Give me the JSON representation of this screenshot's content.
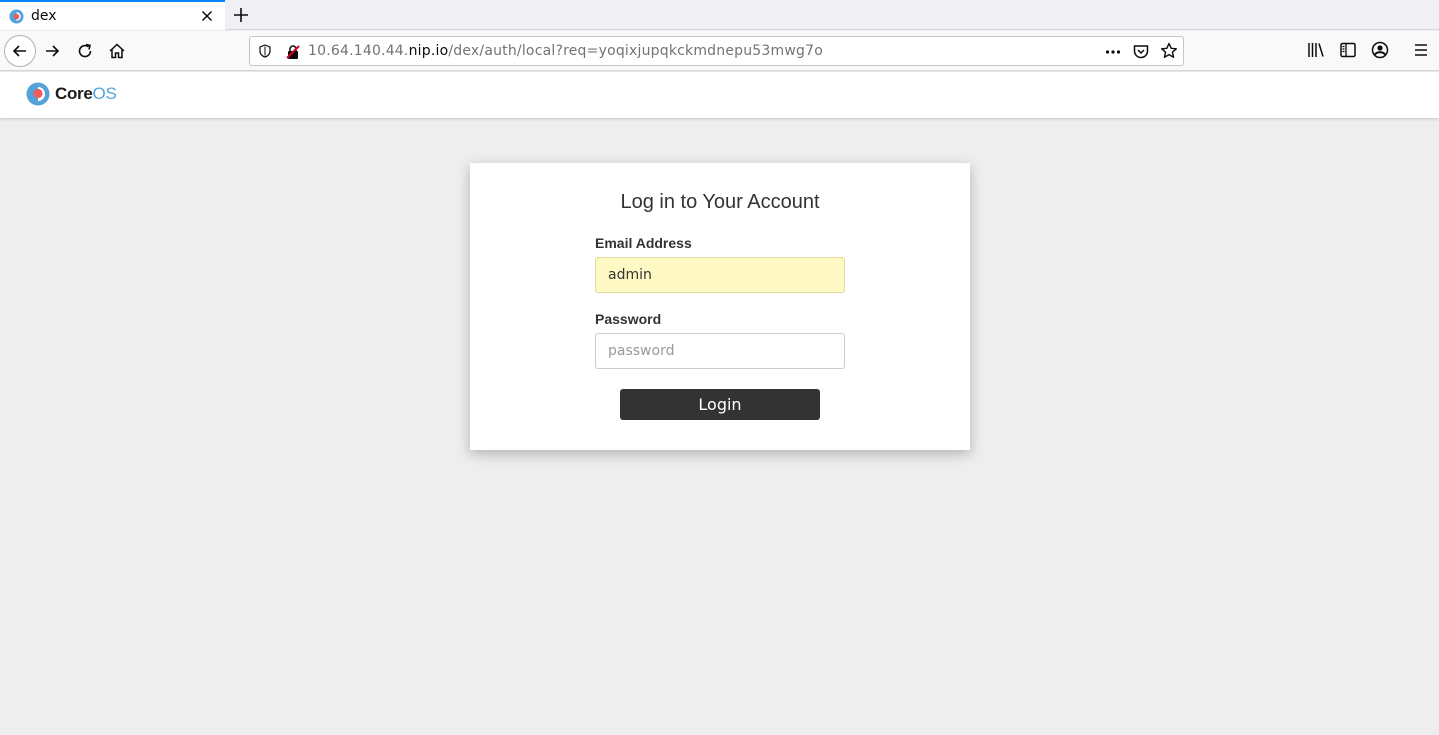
{
  "browser": {
    "tab_title": "dex",
    "url_prefix": "10.64.140.44.",
    "url_host": "nip.io",
    "url_path": "/dex/auth/local?req=yoqixjupqkckmdnepu53mwg7o"
  },
  "header": {
    "logo_core": "Core",
    "logo_os": "OS"
  },
  "login": {
    "title": "Log in to Your Account",
    "email_label": "Email Address",
    "email_value": "admin",
    "password_label": "Password",
    "password_placeholder": "password",
    "button_label": "Login"
  },
  "colors": {
    "accent_tab": "#0a84ff",
    "button_bg": "#333333",
    "autofill_bg": "#fffac3",
    "logo_os": "#53a3da",
    "logo_red": "#ef5d5d"
  }
}
